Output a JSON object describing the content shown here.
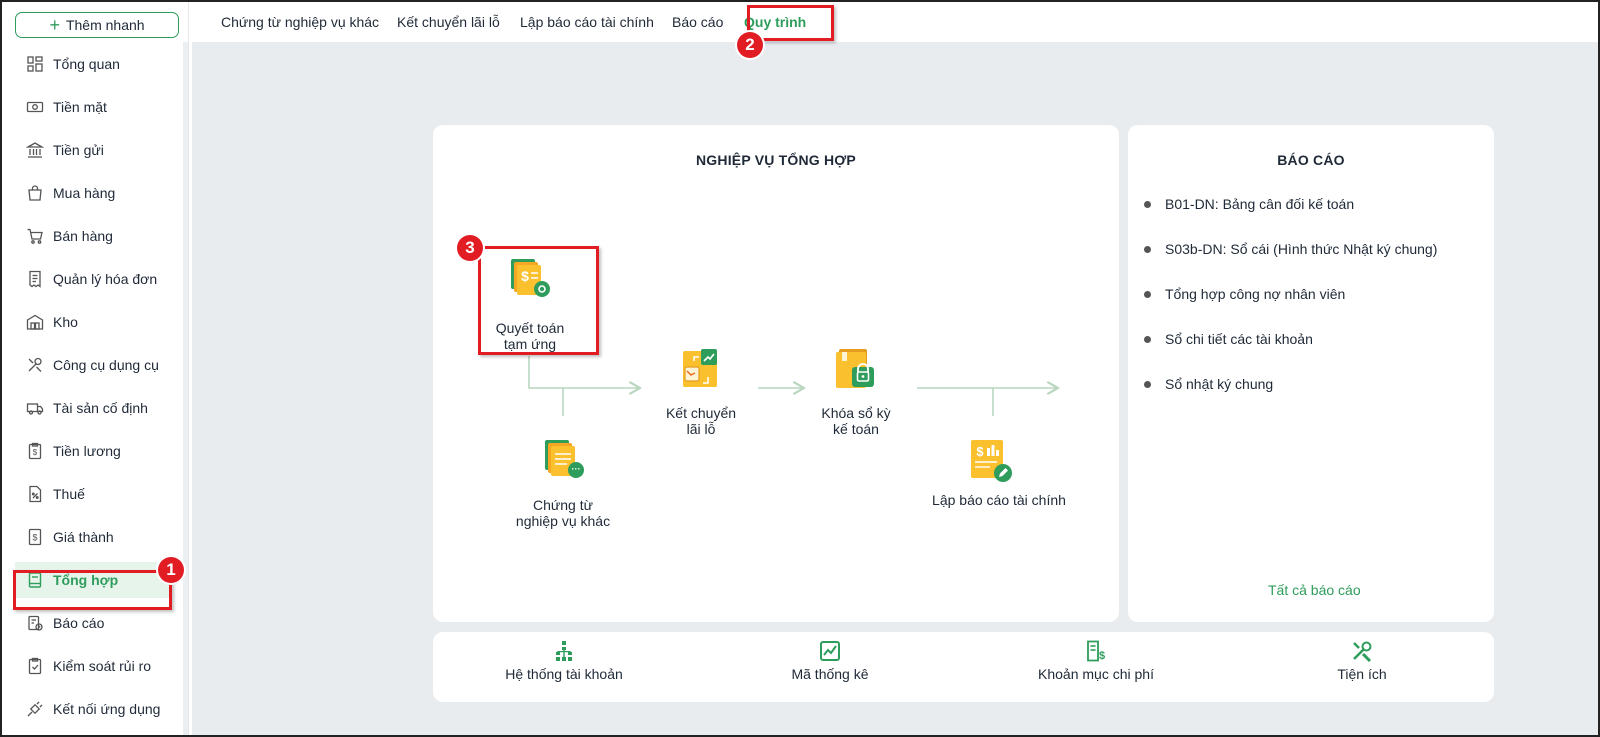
{
  "sidebar": {
    "quick_add": "Thêm nhanh",
    "items": [
      {
        "label": "Tổng quan",
        "icon": "dashboard-icon"
      },
      {
        "label": "Tiền mặt",
        "icon": "cash-icon"
      },
      {
        "label": "Tiền gửi",
        "icon": "bank-icon"
      },
      {
        "label": "Mua hàng",
        "icon": "shopping-bag-icon"
      },
      {
        "label": "Bán hàng",
        "icon": "cart-icon"
      },
      {
        "label": "Quản lý hóa đơn",
        "icon": "invoice-icon"
      },
      {
        "label": "Kho",
        "icon": "warehouse-icon"
      },
      {
        "label": "Công cụ dụng cụ",
        "icon": "tools-icon"
      },
      {
        "label": "Tài sản cố định",
        "icon": "truck-icon"
      },
      {
        "label": "Tiền lương",
        "icon": "payroll-icon"
      },
      {
        "label": "Thuế",
        "icon": "tax-icon"
      },
      {
        "label": "Giá thành",
        "icon": "cost-icon"
      },
      {
        "label": "Tổng hợp",
        "icon": "book-icon",
        "active": true
      },
      {
        "label": "Báo cáo",
        "icon": "report-icon"
      },
      {
        "label": "Kiểm soát rủi ro",
        "icon": "clipboard-check-icon"
      },
      {
        "label": "Kết nối ứng dụng",
        "icon": "plug-icon"
      }
    ]
  },
  "topnav": {
    "tabs": [
      {
        "label": "Chứng từ nghiệp vụ khác"
      },
      {
        "label": "Kết chuyển lãi lỗ"
      },
      {
        "label": "Lập báo cáo tài chính"
      },
      {
        "label": "Báo cáo"
      },
      {
        "label": "Quy trình",
        "active": true
      }
    ]
  },
  "process": {
    "title": "NGHIỆP VỤ TỔNG HỢP",
    "steps": {
      "settle_advance": "Quyết toán\ntạm ứng",
      "other_vouchers": "Chứng từ\nnghiệp vụ khác",
      "profit_transfer": "Kết chuyển\nlãi lỗ",
      "lock_period": "Khóa sổ kỳ\nkế toán",
      "financial_report": "Lập báo cáo tài chính"
    }
  },
  "reports": {
    "title": "BÁO CÁO",
    "items": [
      "B01-DN: Bảng cân đối kế toán",
      "S03b-DN: Sổ cái (Hình thức Nhật ký chung)",
      "Tổng hợp công nợ nhân viên",
      "Sổ chi tiết các tài khoản",
      "Sổ nhật ký chung"
    ],
    "all_link": "Tất cả báo cáo"
  },
  "tools": [
    {
      "label": "Hệ thống tài khoản",
      "icon": "account-tree-icon"
    },
    {
      "label": "Mã thống kê",
      "icon": "chart-icon"
    },
    {
      "label": "Khoản mục chi phí",
      "icon": "expense-doc-icon"
    },
    {
      "label": "Tiện ích",
      "icon": "utility-tools-icon"
    }
  ],
  "annotations": {
    "badge1": "1",
    "badge2": "2",
    "badge3": "3"
  },
  "colors": {
    "accent": "#2e9d5b",
    "annotation": "#e11d23",
    "background": "#e9ecef"
  }
}
